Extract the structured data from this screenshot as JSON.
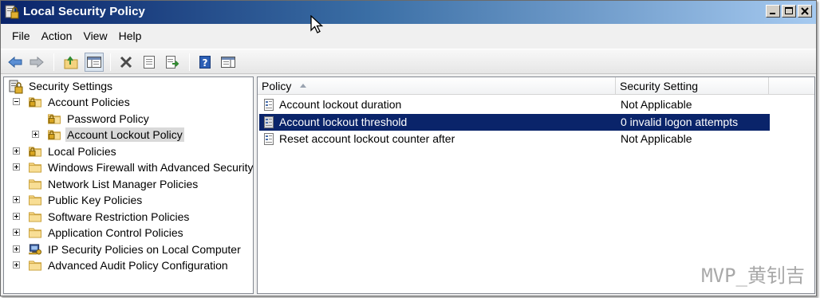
{
  "window": {
    "title": "Local Security Policy",
    "buttons": [
      "minimize",
      "maximize",
      "close"
    ]
  },
  "menu": {
    "items": [
      "File",
      "Action",
      "View",
      "Help"
    ]
  },
  "toolbar": {
    "buttons": [
      "back-icon",
      "forward-icon",
      "up-one-level-icon",
      "show-hide-tree-icon",
      "delete-icon",
      "properties-icon",
      "export-list-icon",
      "help-icon",
      "show-hide-action-pane-icon"
    ]
  },
  "tree": {
    "root": "Security Settings",
    "items": [
      {
        "label": "Account Policies",
        "level": 1,
        "expander": "minus",
        "icon": "folder-lock-icon"
      },
      {
        "label": "Password Policy",
        "level": 2,
        "expander": "none",
        "icon": "folder-lock-icon"
      },
      {
        "label": "Account Lockout Policy",
        "level": 2,
        "expander": "plus",
        "icon": "folder-lock-icon",
        "selected": true
      },
      {
        "label": "Local Policies",
        "level": 1,
        "expander": "plus",
        "icon": "folder-lock-icon"
      },
      {
        "label": "Windows Firewall with Advanced Security",
        "level": 1,
        "expander": "plus",
        "icon": "folder-icon"
      },
      {
        "label": "Network List Manager Policies",
        "level": 1,
        "expander": "none",
        "icon": "folder-icon"
      },
      {
        "label": "Public Key Policies",
        "level": 1,
        "expander": "plus",
        "icon": "folder-icon"
      },
      {
        "label": "Software Restriction Policies",
        "level": 1,
        "expander": "plus",
        "icon": "folder-icon"
      },
      {
        "label": "Application Control Policies",
        "level": 1,
        "expander": "plus",
        "icon": "folder-icon"
      },
      {
        "label": "IP Security Policies on Local Computer",
        "level": 1,
        "expander": "plus",
        "icon": "ip-security-icon"
      },
      {
        "label": "Advanced Audit Policy Configuration",
        "level": 1,
        "expander": "plus",
        "icon": "folder-icon"
      }
    ]
  },
  "list": {
    "columns": [
      "Policy",
      "Security Setting"
    ],
    "rows": [
      {
        "policy": "Account lockout duration",
        "setting": "Not Applicable",
        "selected": false
      },
      {
        "policy": "Account lockout threshold",
        "setting": "0 invalid logon attempts",
        "selected": true
      },
      {
        "policy": "Reset account lockout counter after",
        "setting": "Not Applicable",
        "selected": false
      }
    ]
  },
  "watermark": "MVP_黄钊吉",
  "colors": {
    "selection": "#0a246a",
    "titlebar_start": "#0a246a",
    "titlebar_end": "#a6caf0",
    "folder": "#f4d37f"
  }
}
